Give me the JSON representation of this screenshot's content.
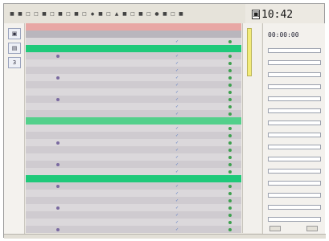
{
  "clock": {
    "time": "10:42"
  },
  "timer": {
    "value": "00:00:00"
  },
  "left_panel": {
    "buttons": [
      {
        "glyph": "▣",
        "label": ""
      },
      {
        "glyph": "▤",
        "label": ""
      },
      {
        "glyph": "3",
        "label": ""
      }
    ]
  },
  "toolbar": {
    "icons": [
      "■",
      "■",
      "□",
      "□",
      "■",
      "□",
      "■",
      "□",
      "■",
      "□",
      "◆",
      "■",
      "□",
      "▲",
      "■",
      "□",
      "■",
      "□",
      "●",
      "■",
      "□",
      "■"
    ]
  },
  "grid": {
    "rows": [
      {
        "kind": "headerhl"
      },
      {
        "kind": "header"
      },
      {
        "kind": "norm",
        "dot": "green"
      },
      {
        "kind": "group"
      },
      {
        "kind": "alt",
        "dot": "green"
      },
      {
        "kind": "norm",
        "dot": "green"
      },
      {
        "kind": "alt",
        "dot": "green"
      },
      {
        "kind": "norm",
        "dot": "green"
      },
      {
        "kind": "alt",
        "dot": "green"
      },
      {
        "kind": "norm",
        "dot": "green"
      },
      {
        "kind": "alt",
        "dot": "green"
      },
      {
        "kind": "norm",
        "dot": "green"
      },
      {
        "kind": "alt",
        "dot": "green"
      },
      {
        "kind": "groupsub"
      },
      {
        "kind": "norm",
        "dot": "green"
      },
      {
        "kind": "alt",
        "dot": "green"
      },
      {
        "kind": "norm",
        "dot": "green"
      },
      {
        "kind": "alt",
        "dot": "green"
      },
      {
        "kind": "norm",
        "dot": "green"
      },
      {
        "kind": "alt",
        "dot": "green"
      },
      {
        "kind": "norm",
        "dot": "green"
      },
      {
        "kind": "group"
      },
      {
        "kind": "alt",
        "dot": "green"
      },
      {
        "kind": "norm",
        "dot": "green"
      },
      {
        "kind": "alt",
        "dot": "green"
      },
      {
        "kind": "norm",
        "dot": "green"
      },
      {
        "kind": "alt",
        "dot": "green"
      },
      {
        "kind": "norm",
        "dot": "green"
      },
      {
        "kind": "alt",
        "dot": "green"
      }
    ]
  },
  "right_panel": {
    "title": "",
    "fields": [
      {
        "label": ""
      },
      {
        "label": ""
      },
      {
        "label": ""
      },
      {
        "label": ""
      },
      {
        "label": ""
      },
      {
        "label": ""
      },
      {
        "label": ""
      },
      {
        "label": ""
      },
      {
        "label": ""
      },
      {
        "label": ""
      },
      {
        "label": ""
      },
      {
        "label": ""
      },
      {
        "label": ""
      },
      {
        "label": ""
      },
      {
        "label": ""
      }
    ],
    "buttons": [
      {
        "label": ""
      },
      {
        "label": ""
      }
    ]
  },
  "statusbar": {
    "text": ""
  },
  "colors": {
    "group_row": "#1fc97a",
    "header_highlight": "#e8a7a4",
    "scroll_thumb": "#f3ec7a",
    "red_text": "#e3343a",
    "blue_text": "#2d3e9a"
  }
}
